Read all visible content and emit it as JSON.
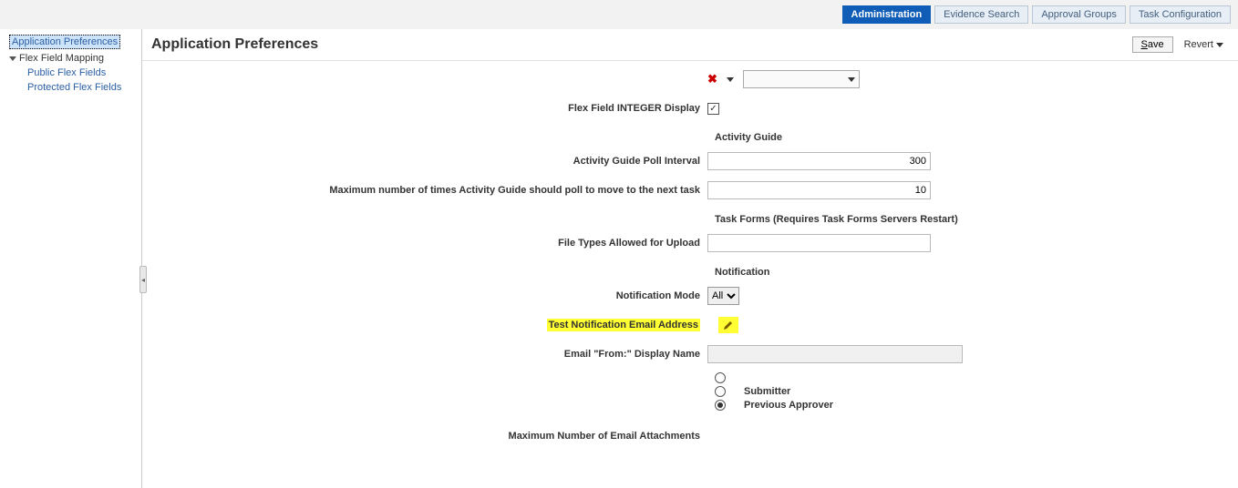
{
  "top_tabs": {
    "administration": "Administration",
    "evidence_search": "Evidence Search",
    "approval_groups": "Approval Groups",
    "task_configuration": "Task Configuration"
  },
  "sidebar": {
    "root": "Application Preferences",
    "flex_mapping": "Flex Field Mapping",
    "public": "Public Flex Fields",
    "protected": "Protected Flex Fields"
  },
  "header": {
    "title": "Application Preferences",
    "save": "Save",
    "revert": "Revert"
  },
  "form": {
    "flex_int_display_label": "Flex Field INTEGER Display",
    "flex_int_display_checked": "✓",
    "section_activity_guide": "Activity Guide",
    "poll_interval_label": "Activity Guide Poll Interval",
    "poll_interval_value": "300",
    "max_poll_label": "Maximum number of times Activity Guide should poll to move to the next task",
    "max_poll_value": "10",
    "section_task_forms": "Task Forms (Requires Task Forms Servers Restart)",
    "file_types_label": "File Types Allowed for Upload",
    "file_types_value": "",
    "section_notification": "Notification",
    "notification_mode_label": "Notification Mode",
    "notification_mode_value": "All",
    "test_email_label": "Test Notification Email Address",
    "email_from_label": "Email \"From:\" Display Name",
    "email_from_value": "",
    "radio_submitter": "Submitter",
    "radio_previous_approver": "Previous Approver",
    "max_attachments_label": "Maximum Number of Email Attachments"
  }
}
